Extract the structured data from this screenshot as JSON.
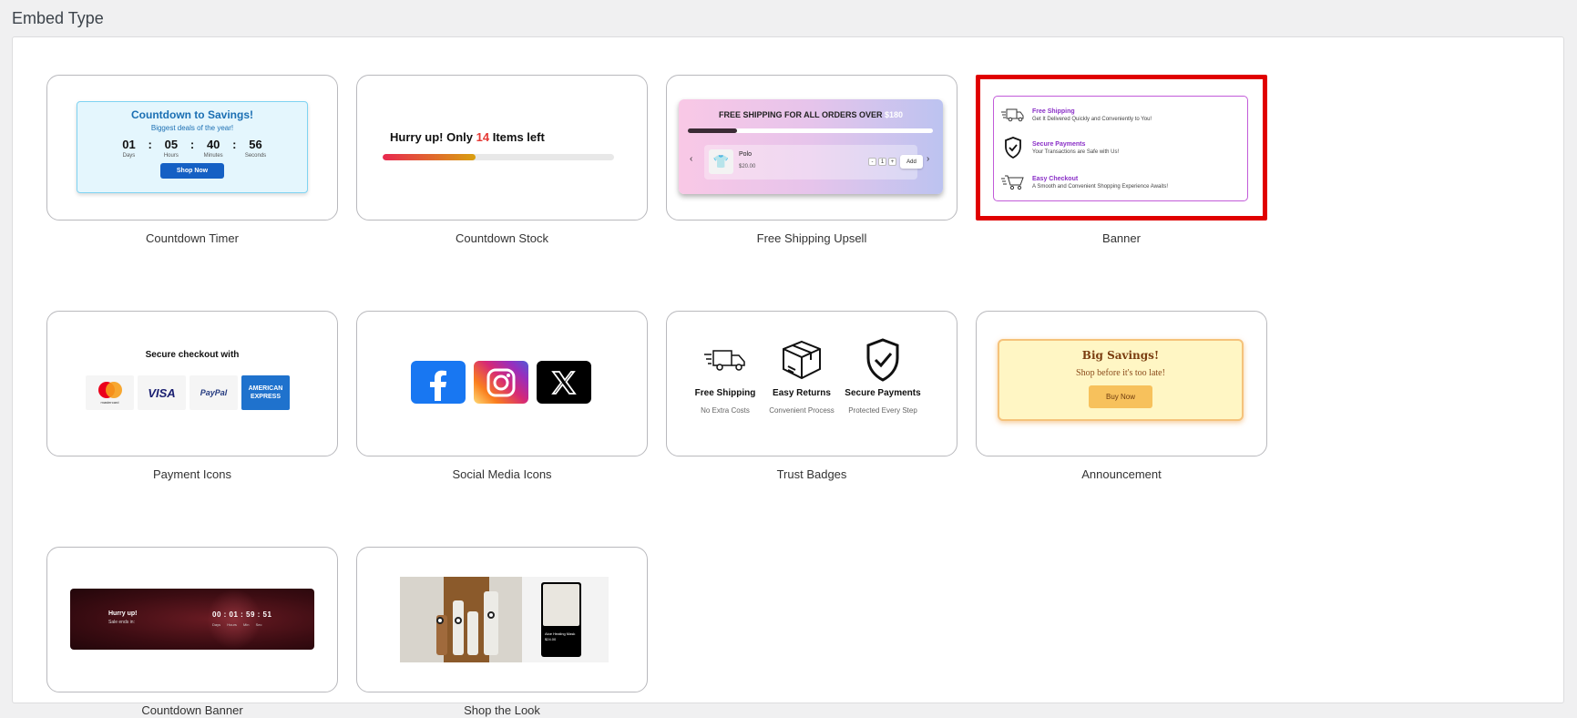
{
  "page": {
    "title": "Embed Type"
  },
  "embeds": [
    {
      "label": "Countdown Timer"
    },
    {
      "label": "Countdown Stock"
    },
    {
      "label": "Free Shipping Upsell"
    },
    {
      "label": "Banner",
      "selected": true
    },
    {
      "label": "Payment Icons"
    },
    {
      "label": "Social Media Icons"
    },
    {
      "label": "Trust Badges"
    },
    {
      "label": "Announcement"
    },
    {
      "label": "Countdown Banner"
    },
    {
      "label": "Shop the Look"
    }
  ],
  "countdown_timer": {
    "title": "Countdown to Savings!",
    "subtitle": "Biggest deals of the year!",
    "units": [
      {
        "value": "01",
        "label": "Days"
      },
      {
        "value": "05",
        "label": "Hours"
      },
      {
        "value": "40",
        "label": "Minutes"
      },
      {
        "value": "56",
        "label": "Seconds"
      }
    ],
    "separator": ":",
    "button": "Shop Now"
  },
  "countdown_stock": {
    "prefix": "Hurry up! Only",
    "count": "14",
    "suffix": "Items left",
    "progress": 0.4
  },
  "free_shipping": {
    "title": "FREE SHIPPING FOR ALL ORDERS OVER",
    "amount": "$180",
    "progress": 0.2,
    "product_name": "Polo",
    "product_price": "$20.00",
    "qty_minus": "-",
    "qty": "1",
    "qty_plus": "+",
    "add": "Add",
    "prev_icon": "chevron-left-icon",
    "next_icon": "chevron-right-icon"
  },
  "banner": {
    "items": [
      {
        "title": "Free Shipping",
        "text": "Get It Delivered Quickly and Conveniently to You!",
        "icon": "truck-icon"
      },
      {
        "title": "Secure Payments",
        "text": "Your Transactions are Safe with Us!",
        "icon": "shield-check-icon"
      },
      {
        "title": "Easy Checkout",
        "text": "A Smooth and Convenient Shopping Experience Awaits!",
        "icon": "cart-icon"
      }
    ],
    "accent": "#8a2fc7"
  },
  "payment_icons": {
    "title": "Secure checkout with",
    "cards": [
      "mastercard",
      "VISA",
      "PayPal",
      "AMERICAN EXPRESS"
    ]
  },
  "social_icons": {
    "icons": [
      "facebook-icon",
      "instagram-icon",
      "x-icon"
    ]
  },
  "trust_badges": {
    "items": [
      {
        "title": "Free Shipping",
        "text": "No Extra Costs",
        "icon": "truck-icon"
      },
      {
        "title": "Easy Returns",
        "text": "Convenient Process",
        "icon": "box-icon"
      },
      {
        "title": "Secure Payments",
        "text": "Protected Every Step",
        "icon": "shield-check-icon"
      }
    ]
  },
  "announcement": {
    "title": "Big Savings!",
    "subtitle": "Shop before it's too late!",
    "button": "Buy Now"
  },
  "countdown_banner": {
    "title": "Hurry up!",
    "subtitle": "Sale ends in:",
    "time": "00 : 01 : 59 : 51",
    "labels": "Days Hours Min Sec"
  },
  "shop_the_look": {
    "card_text": "Aloe Healing Mask $24.00"
  },
  "colors": {
    "selected_border": "#e00000",
    "timer_button": "#1560c4",
    "stock_count": "#e53935"
  }
}
